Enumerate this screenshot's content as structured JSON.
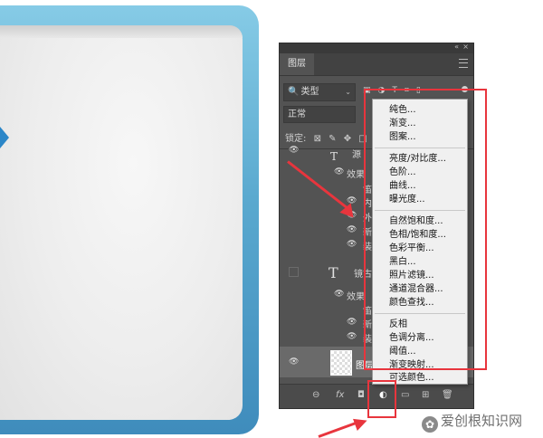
{
  "panel": {
    "collapse_glyph": "«",
    "close_glyph": "×",
    "tab_label": "图层",
    "filter_label": "类型",
    "filter_search_glyph": "🔍",
    "filter_chevron": "⌄",
    "filter_icons": "▣◑T⌗▯",
    "blend_mode": "正常",
    "lock_label": "锁定:",
    "lock_icons": [
      "⊠",
      "✎",
      "✥",
      "□"
    ],
    "layers": {
      "text_layer_label_partial": "源",
      "effects_label": "效果",
      "sub_partial_1": "笛",
      "sub_partial_2": "内",
      "sub_partial_3": "外",
      "sub_partial_4": "新",
      "sub_partial_5": "装",
      "text_layer_2_label": "镜古",
      "effects_label_2": "效果",
      "sub2_partial_1": "笛",
      "sub2_partial_2": "新",
      "sub2_partial_3": "装",
      "selected_layer_label": "图层",
      "text_thumb_glyph": "T"
    },
    "footer_icons": [
      "⊖",
      "fx",
      "◘",
      "◐",
      "▭",
      "⊞",
      "🗑"
    ]
  },
  "adjustment_menu": {
    "groups": [
      [
        "纯色...",
        "渐变...",
        "图案..."
      ],
      [
        "亮度/对比度...",
        "色阶...",
        "曲线...",
        "曝光度..."
      ],
      [
        "自然饱和度...",
        "色相/饱和度...",
        "色彩平衡...",
        "黑白...",
        "照片滤镜...",
        "通道混合器...",
        "颜色查找..."
      ],
      [
        "反相",
        "色调分离...",
        "阈值...",
        "渐变映射...",
        "可选颜色..."
      ]
    ]
  },
  "watermark": {
    "logo_glyph": "✿",
    "text": "爱创根知识网"
  },
  "colors": {
    "annotation_red": "#e8353d",
    "panel_bg": "#535353",
    "canvas_border": "#5aa9cf"
  }
}
